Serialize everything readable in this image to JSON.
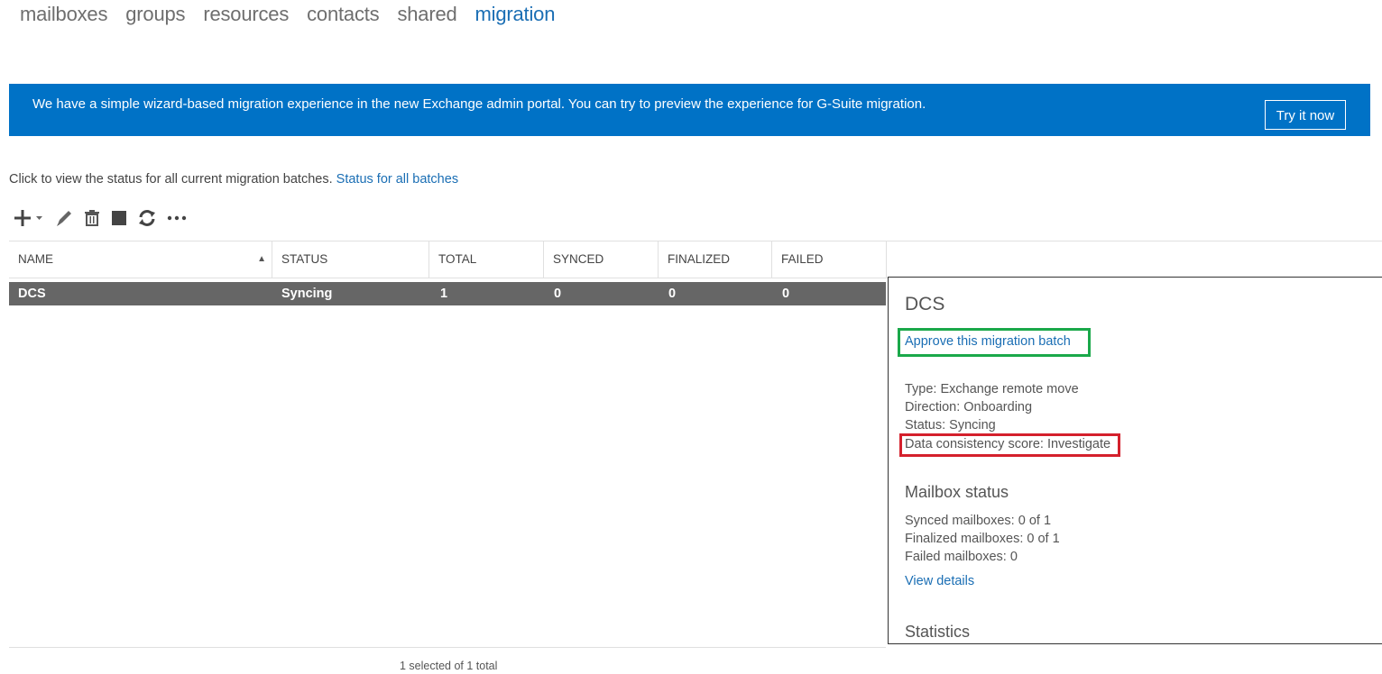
{
  "nav": {
    "tabs": [
      {
        "label": "mailboxes"
      },
      {
        "label": "groups"
      },
      {
        "label": "resources"
      },
      {
        "label": "contacts"
      },
      {
        "label": "shared"
      },
      {
        "label": "migration",
        "active": true
      }
    ]
  },
  "banner": {
    "text": "We have a simple wizard-based migration experience in the new Exchange admin portal. You can try to preview the experience for G-Suite migration.",
    "button_label": "Try it now",
    "color": "#0072c6"
  },
  "status_line": {
    "text": "Click to view the status for all current migration batches.",
    "link_label": "Status for all batches"
  },
  "toolbar": {
    "icons": [
      "add-icon",
      "edit-icon",
      "delete-icon",
      "stop-icon",
      "refresh-icon",
      "more-icon"
    ]
  },
  "table": {
    "columns": [
      {
        "label": "NAME"
      },
      {
        "label": "STATUS"
      },
      {
        "label": "TOTAL"
      },
      {
        "label": "SYNCED"
      },
      {
        "label": "FINALIZED"
      },
      {
        "label": "FAILED"
      }
    ],
    "rows": [
      {
        "name": "DCS",
        "status": "Syncing",
        "total": "1",
        "synced": "0",
        "finalized": "0",
        "failed": "0",
        "selected": true
      }
    ]
  },
  "details": {
    "title": "DCS",
    "approve_link": "Approve this migration batch",
    "type": "Type: Exchange remote move",
    "direction": "Direction: Onboarding",
    "status": "Status: Syncing",
    "consistency": "Data consistency score: Investigate",
    "mailbox_status_heading": "Mailbox status",
    "synced_mailboxes": "Synced mailboxes: 0 of 1",
    "finalized_mailboxes": "Finalized mailboxes: 0 of 1",
    "failed_mailboxes": "Failed mailboxes: 0",
    "view_details_link": "View details",
    "statistics_heading": "Statistics"
  },
  "footer": {
    "text": "1 selected of 1 total"
  }
}
